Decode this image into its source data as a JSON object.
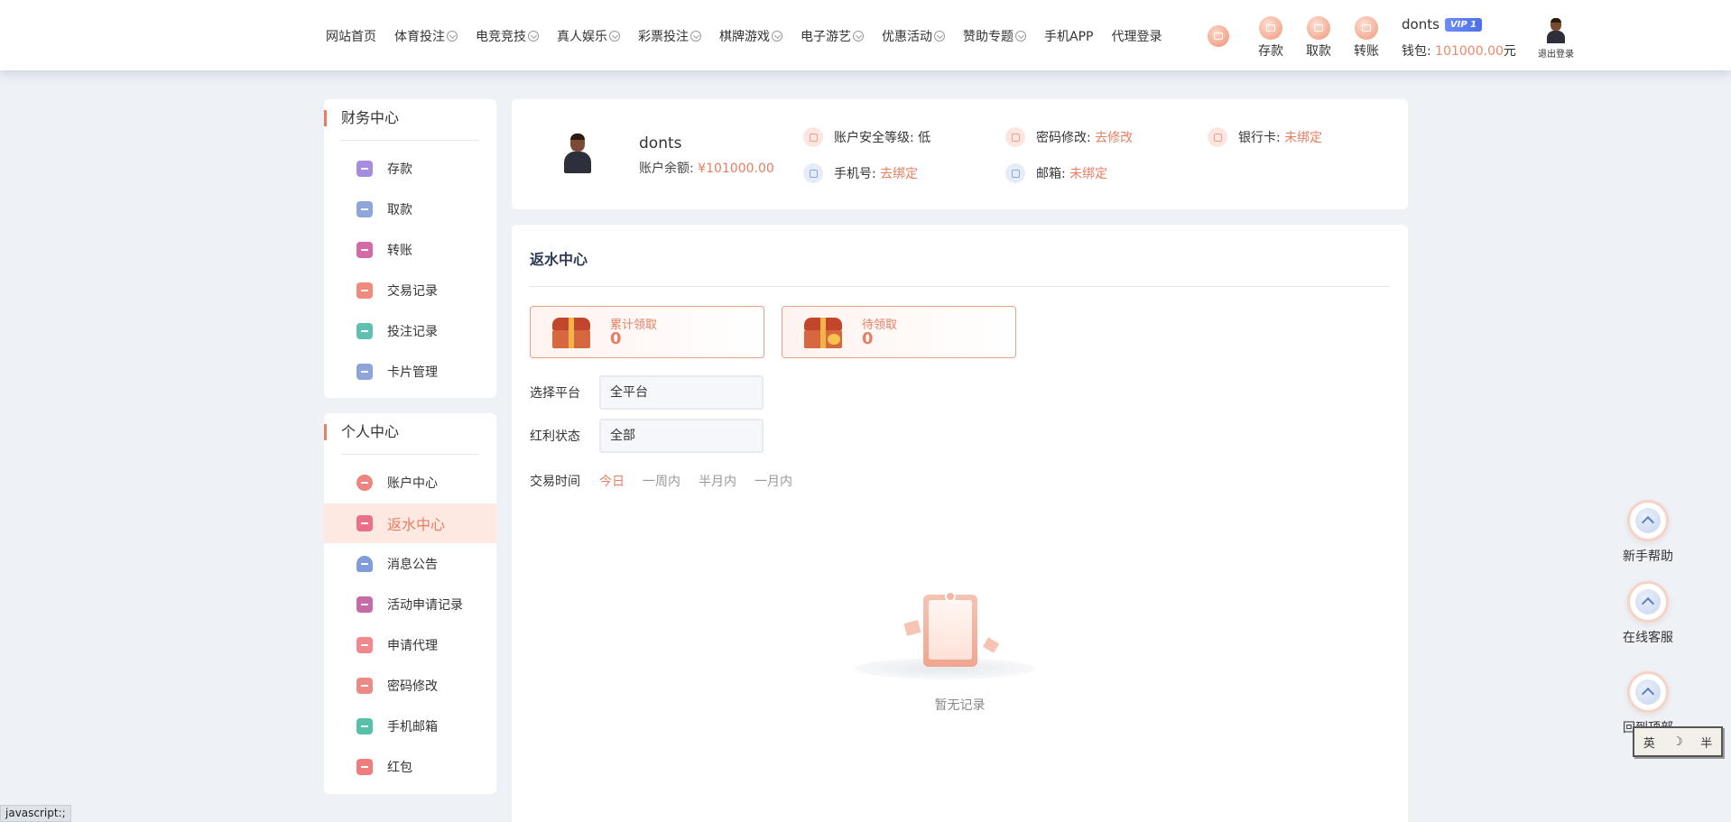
{
  "nav": {
    "items": [
      {
        "label": "网站首页",
        "dropdown": false
      },
      {
        "label": "体育投注",
        "dropdown": true
      },
      {
        "label": "电竞竞技",
        "dropdown": true
      },
      {
        "label": "真人娱乐",
        "dropdown": true
      },
      {
        "label": "彩票投注",
        "dropdown": true
      },
      {
        "label": "棋牌游戏",
        "dropdown": true
      },
      {
        "label": "电子游艺",
        "dropdown": true
      },
      {
        "label": "优惠活动",
        "dropdown": true
      },
      {
        "label": "赞助专题",
        "dropdown": true
      },
      {
        "label": "手机APP",
        "dropdown": false
      },
      {
        "label": "代理登录",
        "dropdown": false
      }
    ],
    "actions": {
      "deposit": "存款",
      "withdraw": "取款",
      "transfer": "转账"
    },
    "user": {
      "name": "donts",
      "vip": "VIP 1",
      "wallet_label": "钱包:",
      "wallet_amount": "101000.00",
      "wallet_unit": "元"
    },
    "logout": "退出登录"
  },
  "sidebar": {
    "finance": {
      "title": "财务中心",
      "items": [
        {
          "label": "存款",
          "color": "#a58ee0"
        },
        {
          "label": "取款",
          "color": "#8da7dc"
        },
        {
          "label": "转账",
          "color": "#d46aa5"
        },
        {
          "label": "交易记录",
          "color": "#ee8b7c"
        },
        {
          "label": "投注记录",
          "color": "#5fbfb0"
        },
        {
          "label": "卡片管理",
          "color": "#8fa4d8"
        }
      ]
    },
    "personal": {
      "title": "个人中心",
      "items": [
        {
          "label": "账户中心",
          "color": "#ec8580"
        },
        {
          "label": "返水中心",
          "color": "#ea7088",
          "active": true
        },
        {
          "label": "消息公告",
          "color": "#7f9cdb"
        },
        {
          "label": "活动申请记录",
          "color": "#c76ba6"
        },
        {
          "label": "申请代理",
          "color": "#f0888e"
        },
        {
          "label": "密码修改",
          "color": "#ec8a86"
        },
        {
          "label": "手机邮箱",
          "color": "#58bfa8"
        },
        {
          "label": "红包",
          "color": "#ef7d7d"
        }
      ]
    }
  },
  "profile": {
    "name": "donts",
    "balance_label": "账户余额:",
    "balance": "¥101000.00",
    "security_label": "账户安全等级:",
    "security_value": "低",
    "password_label": "密码修改:",
    "password_action": "去修改",
    "bank_label": "银行卡:",
    "bank_value": "未绑定",
    "phone_label": "手机号:",
    "phone_action": "去绑定",
    "email_label": "邮箱:",
    "email_value": "未绑定"
  },
  "main": {
    "title": "返水中心",
    "stats": [
      {
        "label": "累计领取",
        "value": "0"
      },
      {
        "label": "待领取",
        "value": "0"
      }
    ],
    "platform_label": "选择平台",
    "platform_value": "全平台",
    "bonus_label": "红利状态",
    "bonus_value": "全部",
    "time_label": "交易时间",
    "time_options": [
      "今日",
      "一周内",
      "半月内",
      "一月内"
    ],
    "time_selected": "今日",
    "empty_text": "暂无记录"
  },
  "floating": {
    "help": "新手帮助",
    "service": "在线客服",
    "top": "回到顶部"
  },
  "ime": {
    "lang": "英",
    "moon": "☽",
    "wide": "半"
  },
  "status_bar": "javascript:;",
  "colors": {
    "accent": "#e77e62",
    "bg": "#eef1f6",
    "navy": "#2f3a55"
  }
}
